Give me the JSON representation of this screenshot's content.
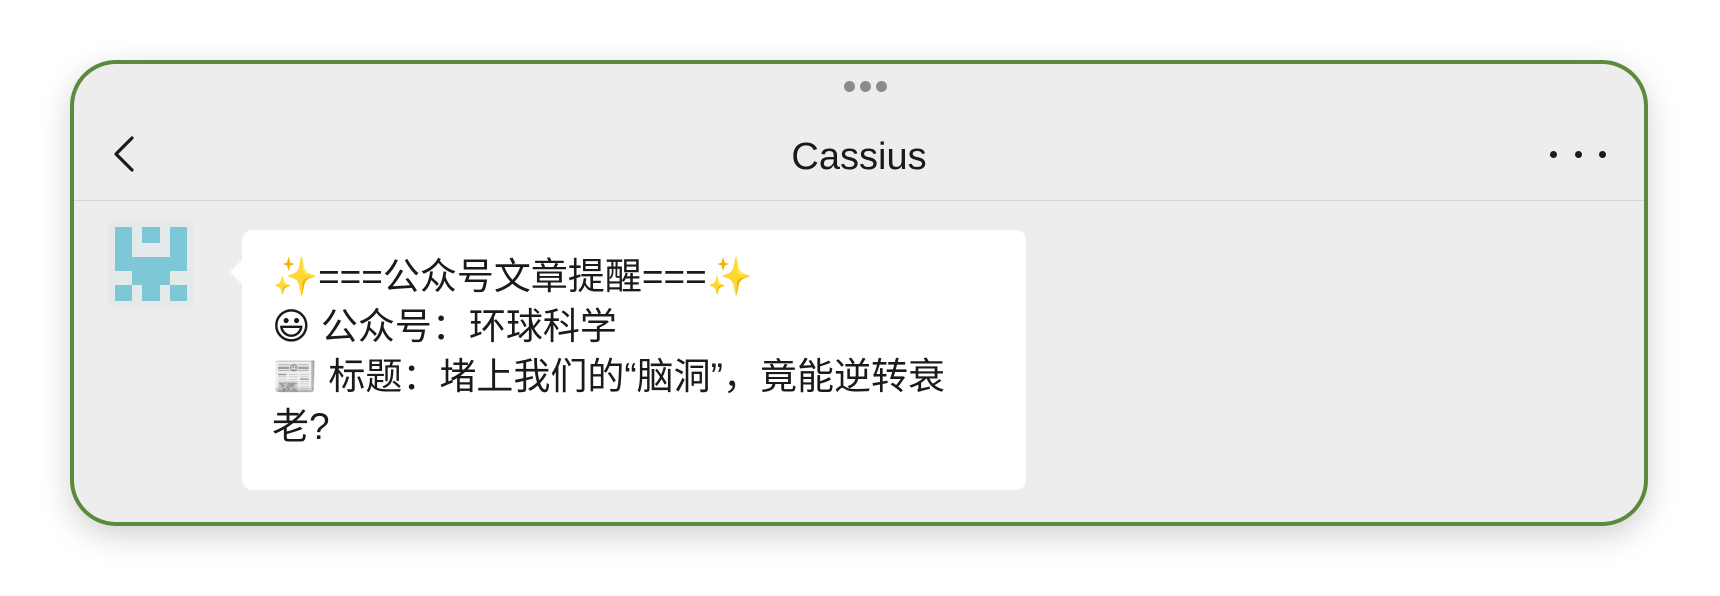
{
  "header": {
    "title": "Cassius"
  },
  "icons": {
    "grabber": "more-horizontal-grabber",
    "back": "chevron-left-icon",
    "more": "ellipsis-icon",
    "avatar": "identicon-avatar"
  },
  "colors": {
    "frame_border": "#5a8a3c",
    "background": "#ededed",
    "bubble": "#ffffff",
    "avatar_pattern": "#7dc7d6"
  },
  "message": {
    "lines": [
      "✨===公众号文章提醒===✨",
      "😃 公众号：环球科学",
      "📰 标题：堵上我们的“脑洞”，竟能逆转衰老?"
    ]
  }
}
